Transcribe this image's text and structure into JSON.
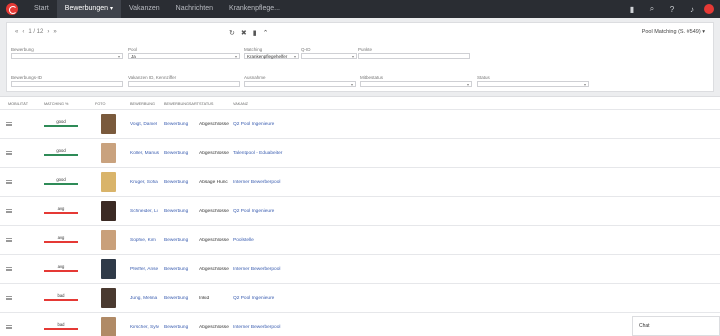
{
  "nav": {
    "items": [
      {
        "label": "Start",
        "active": false
      },
      {
        "label": "Bewerbungen",
        "active": true
      },
      {
        "label": "Vakanzen",
        "active": false
      },
      {
        "label": "Nachrichten",
        "active": false
      },
      {
        "label": "Krankenpflege...",
        "active": false
      }
    ],
    "icons": [
      "bookmark-icon",
      "search-icon",
      "help-icon",
      "bell-icon"
    ]
  },
  "pager": {
    "text": "1 / 12"
  },
  "pool_select": "Pool Matching (S. #549)",
  "filters": {
    "bewerbung": {
      "label": "Bewerbung",
      "value": ""
    },
    "pool": {
      "label": "Pool",
      "value": "Ja"
    },
    "matching": {
      "label": "Matching",
      "value": "Krankenpflegehelfer"
    },
    "q_id": {
      "label": "Q-ID",
      "value": ""
    },
    "punkte": {
      "label": "Punkte",
      "value": ""
    },
    "bewerbungs_id": {
      "label": "Bewerbungs-ID",
      "value": ""
    },
    "vakanzen_id": {
      "label": "Vakanzen ID, Kennziffer",
      "value": ""
    },
    "ausnahme": {
      "label": "Ausnahme",
      "value": ""
    },
    "mitbestatus": {
      "label": "Mitbestatus",
      "value": ""
    },
    "status": {
      "label": "Status",
      "value": ""
    }
  },
  "table": {
    "headers": [
      "Mobilität",
      "Matching %",
      "Foto",
      "Bewerbung",
      "Bewerbungsart",
      "Status",
      "Vakanz"
    ],
    "rows": [
      {
        "match": "good",
        "bar": "#2e8b57",
        "name": "Voigt, Daniel",
        "type": "Bewerbung",
        "status": "Abgeschlosse",
        "vacancy": "Q2 Pool Ingenieure",
        "photo": "#7a5a3c"
      },
      {
        "match": "good",
        "bar": "#2e8b57",
        "name": "Koller, Marius",
        "type": "Bewerbung",
        "status": "Abgeschlosse",
        "vacancy": "Talentpool - Eduabeiter",
        "photo": "#c9a27e"
      },
      {
        "match": "good",
        "bar": "#2e8b57",
        "name": "Kruger, Sofia",
        "type": "Bewerbung",
        "status": "Absage Hunc",
        "vacancy": "Interner Bewerberpool",
        "photo": "#d9b46a"
      },
      {
        "match": "avg",
        "bar": "#e53935",
        "name": "Schneider, Li",
        "type": "Bewerbung",
        "status": "Abgeschlosse",
        "vacancy": "Q2 Pool Ingenieure",
        "photo": "#3b2a24"
      },
      {
        "match": "avg",
        "bar": "#e53935",
        "name": "Sophie, Kim",
        "type": "Bewerbung",
        "status": "Abgeschlosse",
        "vacancy": "Poolstelle",
        "photo": "#c9a07a"
      },
      {
        "match": "avg",
        "bar": "#e53935",
        "name": "Pfeiffer, Anse",
        "type": "Bewerbung",
        "status": "Abgeschlosse",
        "vacancy": "Interner Bewerberpool",
        "photo": "#2f3a48"
      },
      {
        "match": "bad",
        "bar": "#e53935",
        "name": "Jung, Melina",
        "type": "Bewerbung",
        "status": "Inkid",
        "vacancy": "Q2 Pool Ingenieure",
        "photo": "#4a3a30"
      },
      {
        "match": "bad",
        "bar": "#e53935",
        "name": "Kirscher, Sylv",
        "type": "Bewerbung",
        "status": "Abgeschlosse",
        "vacancy": "Interner Bewerberpool",
        "photo": "#b08a66"
      }
    ]
  },
  "chat": {
    "label": "Chat"
  }
}
